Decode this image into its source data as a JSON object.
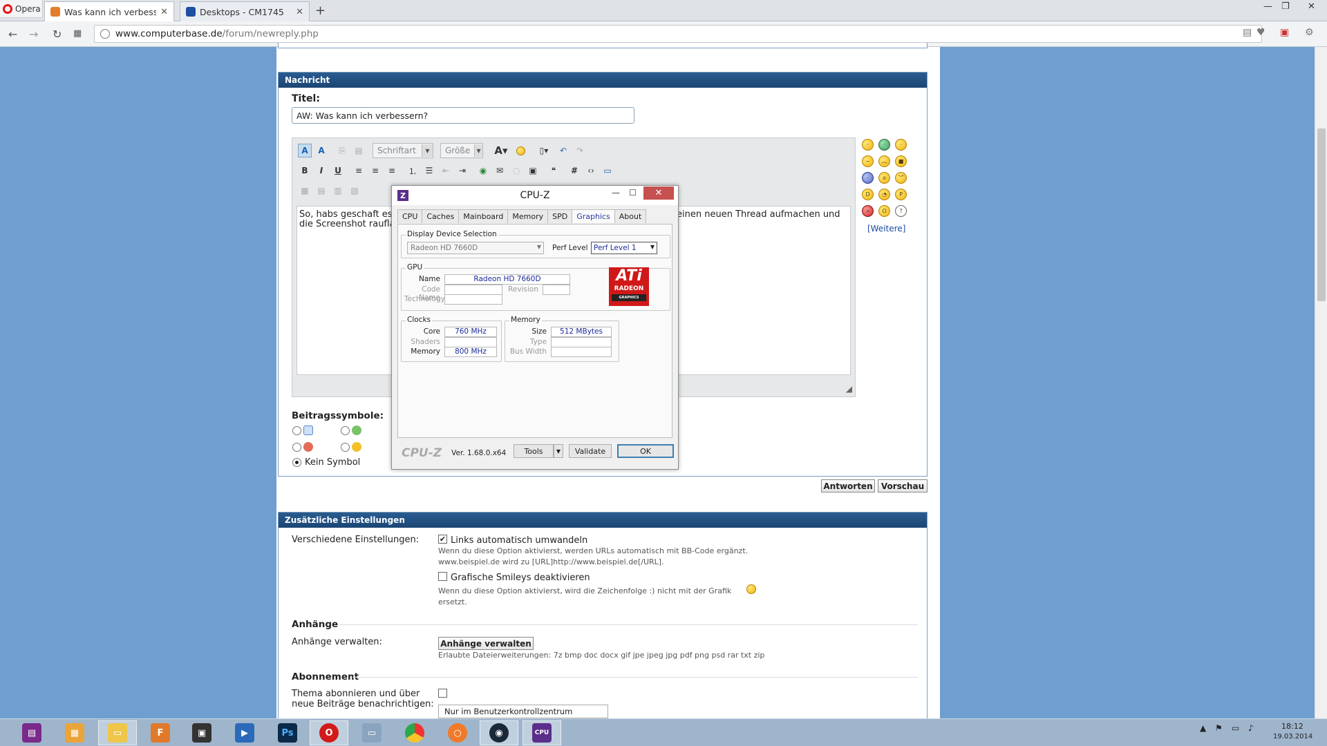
{
  "browser": {
    "menu_label": "Opera",
    "tabs": [
      {
        "label": "Was kann ich verbessern?",
        "active": true
      },
      {
        "label": "Desktops - CM1745",
        "active": false
      }
    ],
    "new_tab": "+",
    "url_host": "www.computerbase.de",
    "url_path": "/forum/newreply.php"
  },
  "nachricht": {
    "header": "Nachricht",
    "titel_label": "Titel:",
    "titel_value": "AW: Was kann ich verbessern?",
    "font_combo": "Schriftart",
    "size_combo": "Größe",
    "message_text": "So, habs geschaft es",
    "message_text_2": "einen neuen Thread aufmachen und",
    "message_text_3": "die Screenshot raufla",
    "weitere": "[Weitere]",
    "symbole_label": "Beitragssymbole:",
    "kein_symbol": "Kein Symbol",
    "btn_antworten": "Antworten",
    "btn_vorschau": "Vorschau"
  },
  "settings": {
    "header": "Zusätzliche Einstellungen",
    "verschiedene_label": "Verschiedene Einstellungen:",
    "links_label": "Links automatisch umwandeln",
    "links_hint_1": "Wenn du diese Option aktivierst, werden URLs automatisch mit BB-Code ergänzt.",
    "links_hint_2": "www.beispiel.de wird zu [URL]http://www.beispiel.de[/URL].",
    "smileys_label": "Grafische Smileys deaktivieren",
    "smileys_hint_1": "Wenn du diese Option aktivierst, wird die Zeichenfolge :) nicht mit der Grafik",
    "smileys_hint_2": "ersetzt.",
    "anhaenge_title": "Anhänge",
    "anhaenge_label": "Anhänge verwalten:",
    "anhaenge_button": "Anhänge verwalten",
    "anhaenge_hint": "Erlaubte Dateierweiterungen: 7z bmp doc docx gif jpe jpeg jpg pdf png psd rar txt zip",
    "abo_title": "Abonnement",
    "abo_label_1": "Thema abonnieren und über",
    "abo_label_2": "neue Beiträge benachrichtigen:",
    "abo_select": "Nur im Benutzerkontrollzentrum"
  },
  "cpuz": {
    "title": "CPU-Z",
    "tabs": [
      "CPU",
      "Caches",
      "Mainboard",
      "Memory",
      "SPD",
      "Graphics",
      "About"
    ],
    "active_tab": "Graphics",
    "display_group": "Display Device Selection",
    "device": "Radeon HD 7660D",
    "perf_label": "Perf Level",
    "perf_value": "Perf Level 1",
    "gpu_group": "GPU",
    "name_label": "Name",
    "name_value": "Radeon HD 7660D",
    "codename_label": "Code Name",
    "revision_label": "Revision",
    "technology_label": "Technology",
    "clocks_group": "Clocks",
    "core_label": "Core",
    "core_value": "760 MHz",
    "shaders_label": "Shaders",
    "memory_label": "Memory",
    "memory_value": "800 MHz",
    "mem_group": "Memory",
    "size_label": "Size",
    "size_value": "512 MBytes",
    "type_label": "Type",
    "buswidth_label": "Bus Width",
    "brand": "CPU-Z",
    "version": "Ver. 1.68.0.x64",
    "tools": "Tools",
    "validate": "Validate",
    "ok": "OK",
    "ati_logo_text": "ATi",
    "ati_sub": "RADEON",
    "ati_sub2": "GRAPHICS"
  },
  "taskbar": {
    "time": "18:12",
    "date": "19.03.2014"
  },
  "colors": {
    "panel_header": "#1b4675",
    "page_bg": "#6f9fd0",
    "cpuz_close": "#c75050"
  }
}
